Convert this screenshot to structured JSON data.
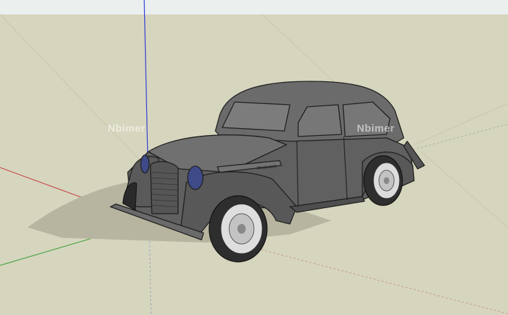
{
  "scene": {
    "sky_color": "#ebefee",
    "ground_color": "#d6d5bd",
    "model": "vintage-sedan"
  },
  "axes": {
    "red": "#c43c3c",
    "green": "#2f9a2f",
    "blue": "#2b3bd6"
  },
  "watermark": {
    "left": "Nbimer",
    "right": "Nbimer"
  },
  "car": {
    "badge": "Moskvitch"
  }
}
